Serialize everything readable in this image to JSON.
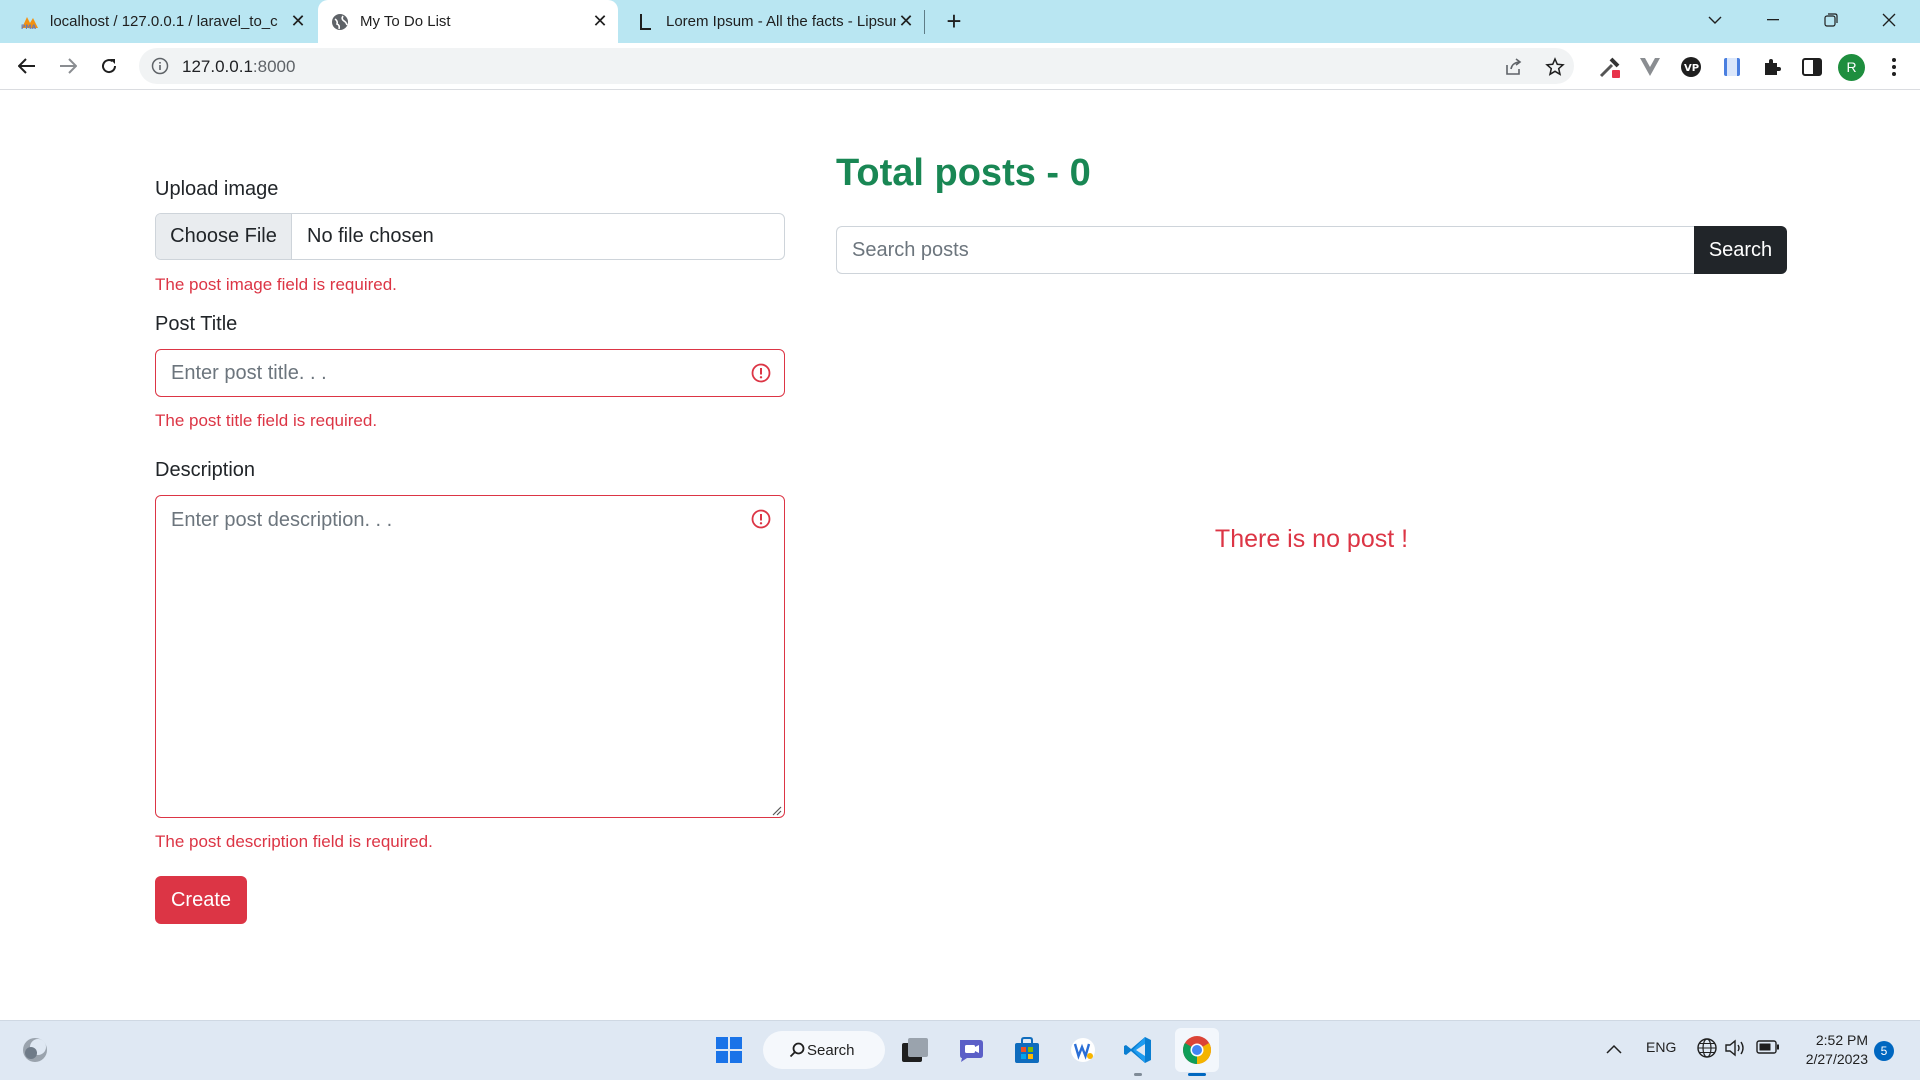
{
  "browser": {
    "tabs": [
      {
        "title": "localhost / 127.0.0.1 / laravel_to_c",
        "favicon": "phpmyadmin-icon"
      },
      {
        "title": "My To Do List",
        "favicon": "globe-icon"
      },
      {
        "title": "Lorem Ipsum - All the facts - Lipsum",
        "favicon": "lipsum-icon"
      }
    ],
    "active_tab": 1,
    "url_host": "127.0.0.1",
    "url_rest": ":8000",
    "profile_initial": "R"
  },
  "form": {
    "upload_label": "Upload image",
    "choose_file_label": "Choose File",
    "file_status": "No file chosen",
    "image_error": "The post image field is required.",
    "title_label": "Post Title",
    "title_placeholder": "Enter post title. . .",
    "title_error": "The post title field is required.",
    "description_label": "Description",
    "description_placeholder": "Enter post description. . .",
    "description_error": "The post description field is required.",
    "create_label": "Create"
  },
  "posts": {
    "total_text": "Total posts - 0",
    "search_placeholder": "Search posts",
    "search_button": "Search",
    "empty_message": "There is no post !"
  },
  "colors": {
    "danger": "#dc3545",
    "success": "#198754",
    "dark": "#212529"
  },
  "taskbar": {
    "search_label": "Search",
    "language": "ENG",
    "time": "2:52 PM",
    "date": "2/27/2023",
    "notifications": "5"
  }
}
